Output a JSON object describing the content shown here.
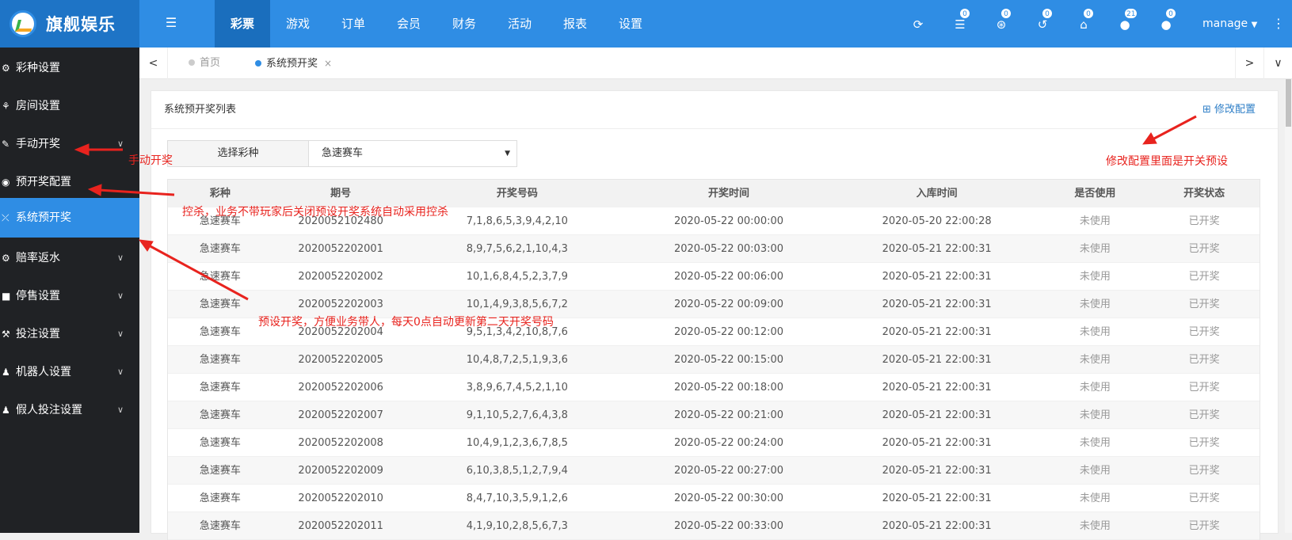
{
  "app": {
    "title": "旗舰娱乐"
  },
  "header": {
    "tabs": [
      {
        "label": "彩票",
        "active": true
      },
      {
        "label": "游戏"
      },
      {
        "label": "订单"
      },
      {
        "label": "会员"
      },
      {
        "label": "财务"
      },
      {
        "label": "活动"
      },
      {
        "label": "报表"
      },
      {
        "label": "设置"
      }
    ],
    "icons": [
      {
        "name": "refresh-icon",
        "glyph": "⟳",
        "badge": ""
      },
      {
        "name": "database-icon",
        "glyph": "☰",
        "badge": "0"
      },
      {
        "name": "support-icon",
        "glyph": "⊛",
        "badge": "0"
      },
      {
        "name": "history-icon",
        "glyph": "↺",
        "badge": "0"
      },
      {
        "name": "home-icon",
        "glyph": "⌂",
        "badge": "0"
      },
      {
        "name": "user-icon",
        "glyph": "●",
        "badge": "21"
      },
      {
        "name": "user-lock-icon",
        "glyph": "●",
        "badge": "0"
      }
    ],
    "user": "manage",
    "user_caret": "▼",
    "more": "⋮"
  },
  "sidebar": {
    "items": [
      {
        "label": "彩种设置",
        "icon": "⚙",
        "chevron": ""
      },
      {
        "label": "房间设置",
        "icon": "⚘",
        "chevron": ""
      },
      {
        "label": "手动开奖",
        "icon": "✎",
        "chevron": "∨"
      },
      {
        "label": "预开奖配置",
        "icon": "◉",
        "chevron": ""
      },
      {
        "label": "系统预开奖",
        "icon": "⤫",
        "chevron": "",
        "active": true
      },
      {
        "label": "赔率返水",
        "icon": "⚙",
        "chevron": "∨"
      },
      {
        "label": "停售设置",
        "icon": "■",
        "chevron": "∨"
      },
      {
        "label": "投注设置",
        "icon": "⚒",
        "chevron": "∨"
      },
      {
        "label": "机器人设置",
        "icon": "♟",
        "chevron": "∨"
      },
      {
        "label": "假人投注设置",
        "icon": "♟",
        "chevron": "∨"
      }
    ]
  },
  "tabsbar": {
    "prev": "<",
    "next": ">",
    "more": "∨",
    "tabs": [
      {
        "label": "首页",
        "active": false
      },
      {
        "label": "系统预开奖",
        "active": true,
        "close": "×"
      }
    ]
  },
  "panel": {
    "title": "系统预开奖列表",
    "edit_config": "⊞ 修改配置",
    "select_label": "选择彩种",
    "select_value": "急速赛车",
    "select_caret": "▼"
  },
  "table": {
    "headers": [
      "彩种",
      "期号",
      "开奖号码",
      "开奖时间",
      "入库时间",
      "是否使用",
      "开奖状态"
    ],
    "rows": [
      [
        "急速赛车",
        "2020052102480",
        "7,1,8,6,5,3,9,4,2,10",
        "2020-05-22 00:00:00",
        "2020-05-20 22:00:28",
        "未使用",
        "已开奖"
      ],
      [
        "急速赛车",
        "2020052202001",
        "8,9,7,5,6,2,1,10,4,3",
        "2020-05-22 00:03:00",
        "2020-05-21 22:00:31",
        "未使用",
        "已开奖"
      ],
      [
        "急速赛车",
        "2020052202002",
        "10,1,6,8,4,5,2,3,7,9",
        "2020-05-22 00:06:00",
        "2020-05-21 22:00:31",
        "未使用",
        "已开奖"
      ],
      [
        "急速赛车",
        "2020052202003",
        "10,1,4,9,3,8,5,6,7,2",
        "2020-05-22 00:09:00",
        "2020-05-21 22:00:31",
        "未使用",
        "已开奖"
      ],
      [
        "急速赛车",
        "2020052202004",
        "9,5,1,3,4,2,10,8,7,6",
        "2020-05-22 00:12:00",
        "2020-05-21 22:00:31",
        "未使用",
        "已开奖"
      ],
      [
        "急速赛车",
        "2020052202005",
        "10,4,8,7,2,5,1,9,3,6",
        "2020-05-22 00:15:00",
        "2020-05-21 22:00:31",
        "未使用",
        "已开奖"
      ],
      [
        "急速赛车",
        "2020052202006",
        "3,8,9,6,7,4,5,2,1,10",
        "2020-05-22 00:18:00",
        "2020-05-21 22:00:31",
        "未使用",
        "已开奖"
      ],
      [
        "急速赛车",
        "2020052202007",
        "9,1,10,5,2,7,6,4,3,8",
        "2020-05-22 00:21:00",
        "2020-05-21 22:00:31",
        "未使用",
        "已开奖"
      ],
      [
        "急速赛车",
        "2020052202008",
        "10,4,9,1,2,3,6,7,8,5",
        "2020-05-22 00:24:00",
        "2020-05-21 22:00:31",
        "未使用",
        "已开奖"
      ],
      [
        "急速赛车",
        "2020052202009",
        "6,10,3,8,5,1,2,7,9,4",
        "2020-05-22 00:27:00",
        "2020-05-21 22:00:31",
        "未使用",
        "已开奖"
      ],
      [
        "急速赛车",
        "2020052202010",
        "8,4,7,10,3,5,9,1,2,6",
        "2020-05-22 00:30:00",
        "2020-05-21 22:00:31",
        "未使用",
        "已开奖"
      ],
      [
        "急速赛车",
        "2020052202011",
        "4,1,9,10,2,8,5,6,7,3",
        "2020-05-22 00:33:00",
        "2020-05-21 22:00:31",
        "未使用",
        "已开奖"
      ]
    ]
  },
  "annotations": {
    "manual": "手动开奖",
    "control": "控杀，业务不带玩家后关闭预设开奖系统自动采用控杀",
    "preset": "预设开奖，方便业务带人，每天0点自动更新第二天开奖号码",
    "config": "修改配置里面是开关预设"
  },
  "colors": {
    "primary": "#2f8de4",
    "sidebar": "#202225",
    "annotation": "#e8231e"
  }
}
